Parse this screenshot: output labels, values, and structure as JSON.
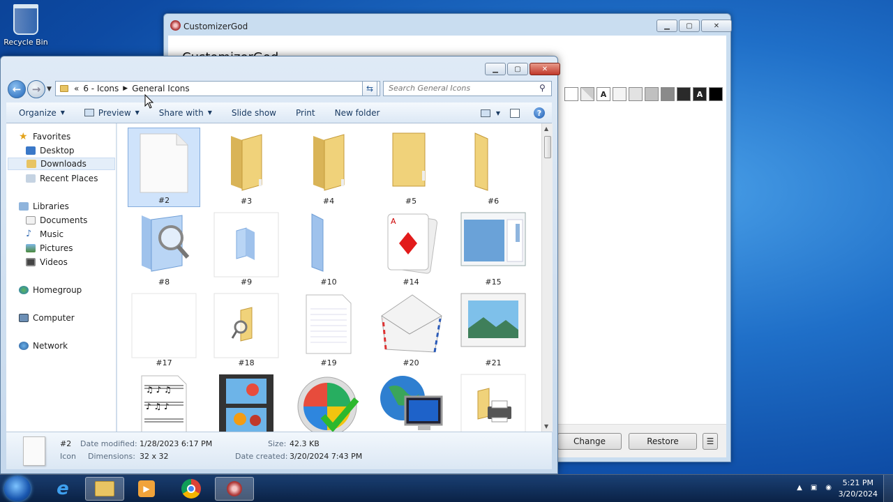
{
  "desktop": {
    "recycle_label": "Recycle Bin"
  },
  "customizer": {
    "title": "CustomizerGod",
    "heading": "CustomizerGod",
    "swatch_letter": "A",
    "change_label": "Change",
    "restore_label": "Restore",
    "menu_glyph": "☰"
  },
  "explorer": {
    "back_glyph": "←",
    "forward_glyph": "→",
    "breadcrumb": {
      "prefix": "«",
      "parent": "6 - Icons",
      "current": "General Icons"
    },
    "search_placeholder": "Search General Icons",
    "toolbar": {
      "organize": "Organize",
      "preview": "Preview",
      "share_with": "Share with",
      "slide_show": "Slide show",
      "print": "Print",
      "new_folder": "New folder",
      "help": "?"
    },
    "nav": {
      "favorites": "Favorites",
      "desktop": "Desktop",
      "downloads": "Downloads",
      "recent_places": "Recent Places",
      "libraries": "Libraries",
      "documents": "Documents",
      "music": "Music",
      "pictures": "Pictures",
      "videos": "Videos",
      "homegroup": "Homegroup",
      "computer": "Computer",
      "network": "Network"
    },
    "tiles": [
      {
        "label": "#2",
        "icon": "blank-page-icon"
      },
      {
        "label": "#3",
        "icon": "folder-icon"
      },
      {
        "label": "#4",
        "icon": "folder-icon"
      },
      {
        "label": "#5",
        "icon": "folder-icon"
      },
      {
        "label": "#6",
        "icon": "folder-side-icon"
      },
      {
        "label": "#8",
        "icon": "search-folder-icon"
      },
      {
        "label": "#9",
        "icon": "small-blue-folder-icon"
      },
      {
        "label": "#10",
        "icon": "blue-folder-side-icon"
      },
      {
        "label": "#14",
        "icon": "playing-cards-icon"
      },
      {
        "label": "#15",
        "icon": "window-preview-icon"
      },
      {
        "label": "#17",
        "icon": "empty-icon"
      },
      {
        "label": "#18",
        "icon": "folder-magnifier-icon"
      },
      {
        "label": "#19",
        "icon": "text-document-icon"
      },
      {
        "label": "#20",
        "icon": "envelope-icon"
      },
      {
        "label": "#21",
        "icon": "landscape-photo-icon"
      },
      {
        "label": "",
        "icon": "sheet-music-icon"
      },
      {
        "label": "",
        "icon": "film-strip-icon"
      },
      {
        "label": "",
        "icon": "windows-check-icon"
      },
      {
        "label": "",
        "icon": "globe-monitor-icon"
      },
      {
        "label": "",
        "icon": "folder-printer-icon"
      }
    ],
    "details": {
      "name": "#2",
      "type": "Icon",
      "date_modified_label": "Date modified:",
      "date_modified": "1/28/2023 6:17 PM",
      "dimensions_label": "Dimensions:",
      "dimensions": "32 x 32",
      "size_label": "Size:",
      "size": "42.3 KB",
      "date_created_label": "Date created:",
      "date_created": "3/20/2024 7:43 PM"
    }
  },
  "taskbar": {
    "time": "5:21 PM",
    "date": "3/20/2024"
  },
  "colors": {
    "accent": "#1f64b8",
    "folder": "#e8c463",
    "selection": "#cfe3fb"
  }
}
